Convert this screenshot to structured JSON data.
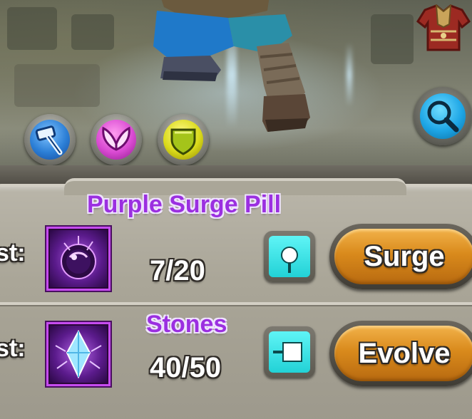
{
  "upgrade": {
    "surge": {
      "title": "Purple Surge Pill",
      "cost_label": "st:",
      "count": "7/20",
      "button_label": "Surge"
    },
    "evolve": {
      "title": "Stones",
      "cost_label": "st:",
      "count": "40/50",
      "button_label": "Evolve"
    }
  },
  "icons": {
    "skills": [
      "hammer-icon",
      "wings-icon",
      "shield-icon"
    ],
    "search": "magnifier-icon",
    "equipment": "armor-icon",
    "surge_item": "purple-surge-pill-icon",
    "evolve_item": "crystal-stone-icon"
  },
  "colors": {
    "title_purple": "#9b2fe0",
    "button_orange": "#d98a1c",
    "toggle_cyan": "#22d2d6"
  }
}
